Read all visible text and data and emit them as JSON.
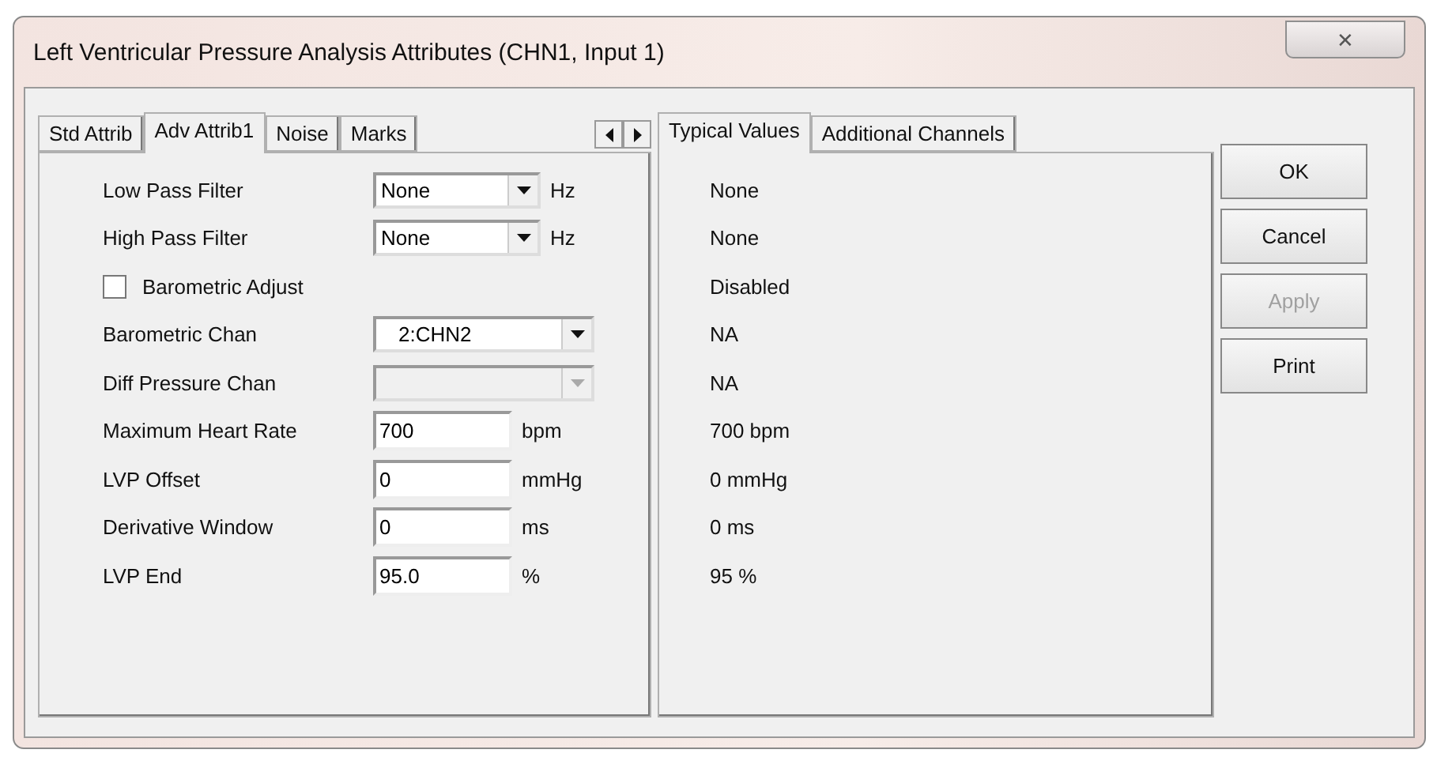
{
  "window": {
    "title": "Left Ventricular Pressure Analysis Attributes  (CHN1, Input 1)",
    "close": "✕"
  },
  "left_tabs": [
    {
      "label": "Std Attrib",
      "selected": false
    },
    {
      "label": "Adv Attrib1",
      "selected": true
    },
    {
      "label": "Noise",
      "selected": false
    },
    {
      "label": "Marks",
      "selected": false
    }
  ],
  "fields": [
    {
      "kind": "dropdown",
      "label": "Low Pass Filter",
      "value": "None",
      "unit": "Hz",
      "disabled": false
    },
    {
      "kind": "dropdown",
      "label": "High Pass Filter",
      "value": "None",
      "unit": "Hz",
      "disabled": false
    },
    {
      "kind": "checkbox",
      "label": "Barometric Adjust",
      "checked": false
    },
    {
      "kind": "dropdown",
      "label": "Barometric Chan",
      "value": "2:CHN2",
      "disabled": false
    },
    {
      "kind": "dropdown",
      "label": "Diff Pressure Chan",
      "disabled": true
    },
    {
      "kind": "text",
      "label": "Maximum Heart Rate",
      "value": "700",
      "unit": "bpm"
    },
    {
      "kind": "text",
      "label": "LVP Offset",
      "value": "0",
      "unit": "mmHg"
    },
    {
      "kind": "text",
      "label": "Derivative Window",
      "value": "0",
      "unit": "ms"
    },
    {
      "kind": "text",
      "label": "LVP End",
      "value": "95.0",
      "unit": "%"
    }
  ],
  "right_tabs": [
    {
      "label": "Typical Values",
      "selected": true
    },
    {
      "label": "Additional Channels",
      "selected": false
    }
  ],
  "typical_values": [
    "None",
    "None",
    "Disabled",
    "NA",
    "NA",
    "700 bpm",
    "0 mmHg",
    "0 ms",
    "95 %"
  ],
  "buttons": [
    {
      "label": "OK",
      "disabled": false
    },
    {
      "label": "Cancel",
      "disabled": false
    },
    {
      "label": "Apply",
      "disabled": true
    },
    {
      "label": "Print",
      "disabled": false
    }
  ]
}
